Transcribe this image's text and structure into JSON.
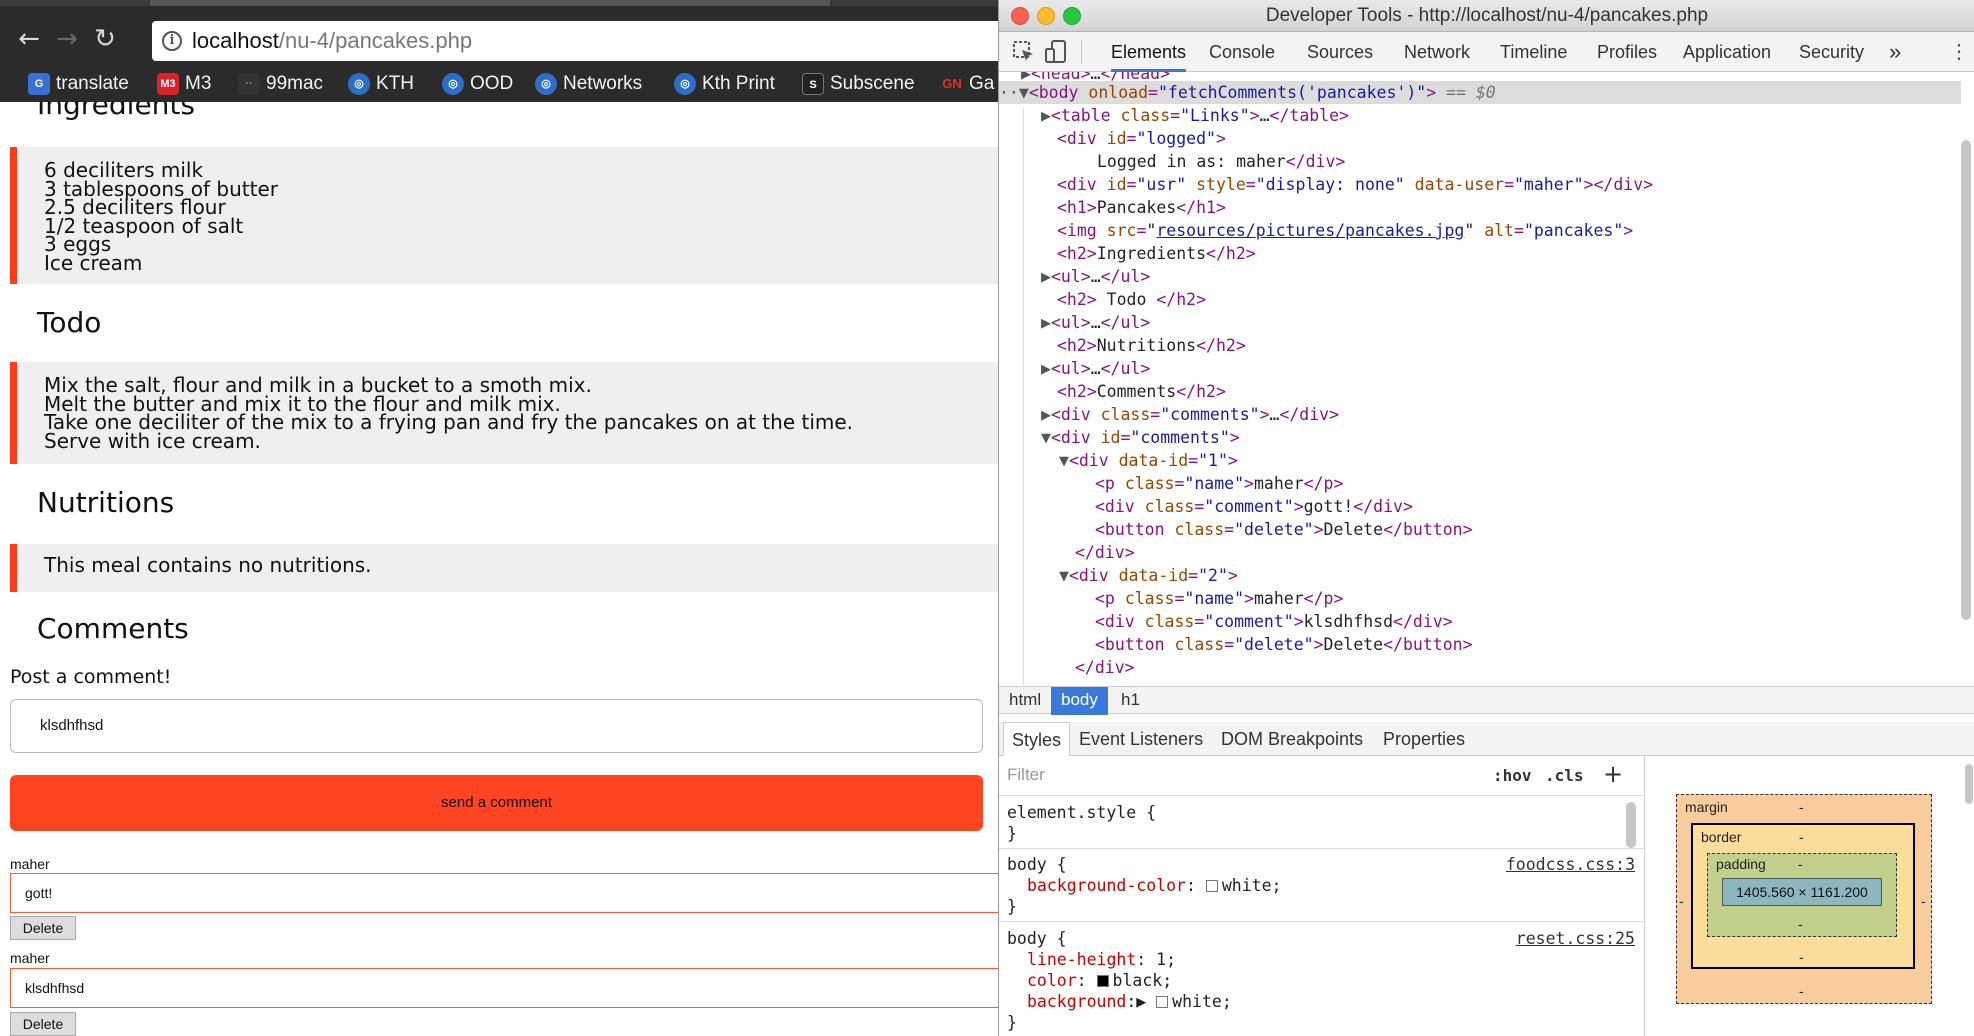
{
  "browser": {
    "url_host": "localhost",
    "url_path": "/nu-4/pancakes.php",
    "bookmarks": [
      {
        "label": "translate",
        "icon": "google-translate-icon"
      },
      {
        "label": "M3",
        "icon": "m3-icon"
      },
      {
        "label": "99mac",
        "icon": "99mac-icon"
      },
      {
        "label": "KTH",
        "icon": "kth-icon"
      },
      {
        "label": "OOD",
        "icon": "kth-icon"
      },
      {
        "label": "Networks",
        "icon": "kth-icon"
      },
      {
        "label": "Kth Print",
        "icon": "kth-icon"
      },
      {
        "label": "Subscene",
        "icon": "subscene-icon"
      },
      {
        "label": "Ga",
        "icon": "gn-icon"
      }
    ],
    "icon_texts": {
      "translate": "G",
      "m3": "M3",
      "mac": "··",
      "kth": "◎",
      "s": "S",
      "gn": "GN"
    }
  },
  "page": {
    "ingredients_heading": "Ingredients",
    "ingredients": [
      "6 deciliters milk",
      "3 tablespoons of butter",
      "2.5 deciliters flour",
      "1/2 teaspoon of salt",
      "3 eggs",
      "Ice cream"
    ],
    "todo_heading": "Todo",
    "todo": [
      "Mix the salt, flour and milk in a bucket to a smoth mix.",
      "Melt the butter and mix it to the flour and milk mix.",
      "Take one deciliter of the mix to a frying pan and fry the pancakes on at the time.",
      "Serve with ice cream."
    ],
    "nutritions_heading": "Nutritions",
    "nutritions": [
      "This meal contains no nutritions."
    ],
    "comments_heading": "Comments",
    "post_label": "Post a comment!",
    "comment_input_value": "klsdhfhsd",
    "send_button": "send a comment",
    "comments": [
      {
        "name": "maher",
        "text": "gott!",
        "delete": "Delete"
      },
      {
        "name": "maher",
        "text": "klsdhfhsd",
        "delete": "Delete"
      }
    ],
    "accent_color": "#ff4422"
  },
  "devtools": {
    "title": "Developer Tools - http://localhost/nu-4/pancakes.php",
    "tabs": [
      "Elements",
      "Console",
      "Sources",
      "Network",
      "Timeline",
      "Profiles",
      "Application",
      "Security"
    ],
    "active_tab": "Elements",
    "more_tabs": "»",
    "menu": "⋮",
    "breadcrumbs": [
      "html",
      "body",
      "h1"
    ],
    "active_breadcrumb": "body",
    "styles_tabs": [
      "Styles",
      "Event Listeners",
      "DOM Breakpoints",
      "Properties"
    ],
    "filter_placeholder": "Filter",
    "hov": ":hov",
    "cls": ".cls",
    "plus": "+",
    "box_model": {
      "margin_label": "margin",
      "border_label": "border",
      "padding_label": "padding",
      "content_size": "1405.560 × 1161.200",
      "dash": "-"
    },
    "accent_color": "#3879d9"
  }
}
